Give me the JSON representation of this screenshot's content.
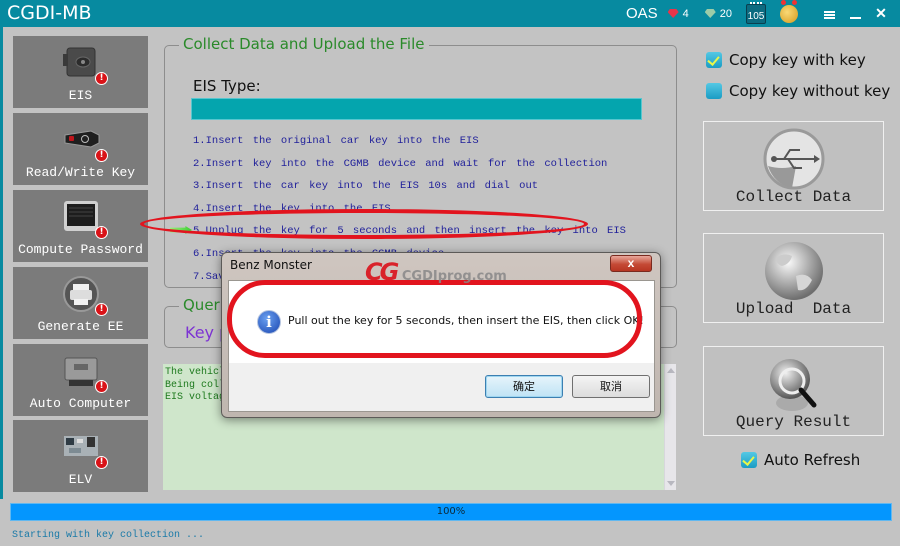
{
  "titlebar": {
    "app_title": "CGDI-MB",
    "oas_label": "OAS",
    "red_gem_count": "4",
    "green_gem_count": "20",
    "calendar_days": "105",
    "icons": [
      "red-gem-icon",
      "green-gem-icon",
      "calendar-icon",
      "medal-icon",
      "menu-icon",
      "minimize-icon",
      "close-icon"
    ],
    "close_glyph": "✕"
  },
  "sidebar": {
    "items": [
      {
        "label": "EIS",
        "icon": "eis-module-icon"
      },
      {
        "label": "Read/Write Key",
        "icon": "car-key-icon"
      },
      {
        "label": "Compute Password",
        "icon": "monitor-icon"
      },
      {
        "label": "Generate EE",
        "icon": "printer-icon"
      },
      {
        "label": "Auto Computer",
        "icon": "ecu-icon"
      },
      {
        "label": "ELV",
        "icon": "circuit-board-icon"
      }
    ],
    "warning_glyph": "!"
  },
  "collect_group": {
    "title": "Collect Data and Upload the File",
    "eis_type_label": "EIS Type:",
    "eis_type_value": "",
    "steps": [
      "1.Insert the original car key into the EIS",
      "2.Insert key into the CGMB device and wait for the collection",
      "3.Insert the car key into the EIS 10s and dial out",
      "4.Insert the key into the EIS",
      "5.Unplug the key for 5 seconds and then insert the key into EIS",
      "6.Insert the key into the CGMB device",
      "7.Sav"
    ],
    "current_step": 5
  },
  "query_group": {
    "title": "Quer",
    "key_label": "Key p"
  },
  "log": {
    "lines": [
      "The vehicl",
      "Being coll",
      "EIS voltag"
    ]
  },
  "right_panel": {
    "copy_with_key": {
      "label": "Copy key with key",
      "checked": true
    },
    "copy_without_key": {
      "label": "Copy key without key",
      "checked": false
    },
    "collect_data_label": "Collect Data",
    "upload_data_label": "Upload  Data",
    "query_result_label": "Query Result",
    "auto_refresh": {
      "label": "Auto Refresh",
      "checked": true
    }
  },
  "progress": {
    "value_percent": 100,
    "label": "100%"
  },
  "status_text": "Starting with key collection ...",
  "dialog": {
    "title": "Benz Monster",
    "close_glyph": "x",
    "info_glyph": "i",
    "message": "Pull out the key for 5 seconds, then insert the EIS, then click OK!",
    "ok_label": "确定",
    "cancel_label": "取消"
  },
  "watermark": {
    "logo": "CG",
    "site": "CGDIprog.com"
  },
  "colors": {
    "titlebar": "#078aa0",
    "eis_bar": "#04a5ae",
    "progress": "#0496fe",
    "highlight": "#e2141e",
    "group_title": "#2a8a2a",
    "step_text": "#1f1f9a",
    "log_bg": "#cfe6cb"
  }
}
